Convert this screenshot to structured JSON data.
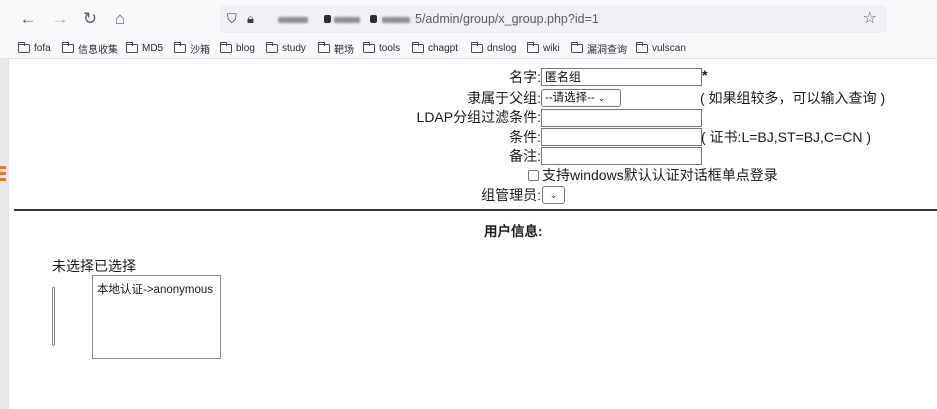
{
  "browser": {
    "url_suffix": "5/admin/group/x_group.php?id=1",
    "bookmarks": [
      "fofa",
      "信息收集",
      "MD5",
      "沙箱",
      "blog",
      "study",
      "靶场",
      "tools",
      "chagpt",
      "dnslog",
      "wiki",
      "漏洞查询",
      "vulscan"
    ]
  },
  "form": {
    "name_label": "名字:",
    "name_value": "匿名组",
    "required_mark": "*",
    "parent_label": "隶属于父组:",
    "parent_select": "--请选择--",
    "parent_hint": "( 如果组较多，可以输入查询 )",
    "ldap_label": "LDAP分组过滤条件:",
    "cond_label": "条件:",
    "cond_hint": "( 证书:L=BJ,ST=BJ,C=CN )",
    "note_label": "备注:",
    "sso_label": "支持windows默认认证对话框单点登录",
    "admin_label": "组管理员:"
  },
  "user_info": {
    "title": "用户信息:",
    "columns_label": "未选择已选择",
    "selected_items": [
      "本地认证->anonymous"
    ]
  }
}
